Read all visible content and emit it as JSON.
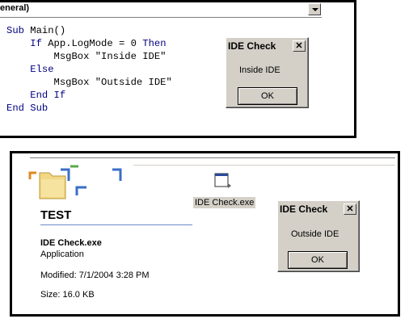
{
  "code_window": {
    "object_combo": "eneral)",
    "lines": [
      {
        "indent": "",
        "parts": [
          {
            "k": "Sub ",
            "t": "Main()"
          }
        ]
      },
      {
        "indent": "    ",
        "parts": [
          {
            "k": "If ",
            "t": "App.LogMode = 0 "
          },
          {
            "k": "Then",
            "t": ""
          }
        ]
      },
      {
        "indent": "        ",
        "parts": [
          {
            "k": "",
            "t": "MsgBox \"Inside IDE\""
          }
        ]
      },
      {
        "indent": "    ",
        "parts": [
          {
            "k": "Else",
            "t": ""
          }
        ]
      },
      {
        "indent": "        ",
        "parts": [
          {
            "k": "",
            "t": "MsgBox \"Outside IDE\""
          }
        ]
      },
      {
        "indent": "    ",
        "parts": [
          {
            "k": "End If",
            "t": ""
          }
        ]
      },
      {
        "indent": "",
        "parts": [
          {
            "k": "End Sub",
            "t": ""
          }
        ]
      }
    ]
  },
  "dialog_inside": {
    "title": "IDE Check",
    "close": "✕",
    "message": "Inside IDE",
    "ok_label": "OK"
  },
  "explorer": {
    "folder_title": "TEST",
    "file_name": "IDE Check.exe",
    "file_type": "Application",
    "modified": "Modified: 7/1/2004 3:28 PM",
    "size": "Size: 16.0 KB",
    "exe_label": "IDE Check.exe"
  },
  "dialog_outside": {
    "title": "IDE Check",
    "close": "✕",
    "message": "Outside IDE",
    "ok_label": "OK"
  },
  "colors": {
    "keyword": "#000080",
    "dialog_face": "#d4d0c8"
  }
}
